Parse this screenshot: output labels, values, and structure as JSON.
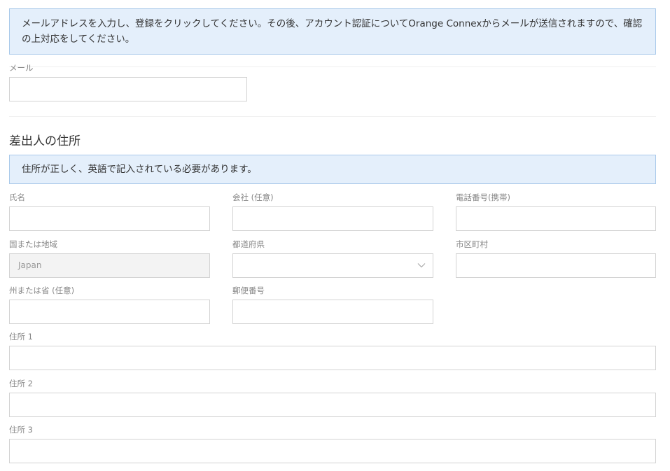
{
  "top_notice": "メールアドレスを入力し、登録をクリックしてください。その後、アカウント認証についてOrange Connexからメールが送信されますので、確認の上対応をしてください。",
  "email": {
    "label": "メール",
    "value": ""
  },
  "sender": {
    "title": "差出人の住所",
    "notice": "住所が正しく、英語で記入されている必要があります。",
    "name": {
      "label": "氏名",
      "value": ""
    },
    "company": {
      "label": "会社 (任意)",
      "value": ""
    },
    "phone": {
      "label": "電話番号(携帯)",
      "value": ""
    },
    "country": {
      "label": "国または地域",
      "value": "Japan"
    },
    "prefecture": {
      "label": "都道府県",
      "value": ""
    },
    "city": {
      "label": "市区町村",
      "value": ""
    },
    "state": {
      "label": "州または省 (任意)",
      "value": ""
    },
    "postal": {
      "label": "郵便番号",
      "value": ""
    },
    "address1": {
      "label": "住所 1",
      "value": ""
    },
    "address2": {
      "label": "住所 2",
      "value": ""
    },
    "address3": {
      "label": "住所 3",
      "value": ""
    }
  },
  "icons": {
    "dropdown": "chevron-down-icon"
  }
}
